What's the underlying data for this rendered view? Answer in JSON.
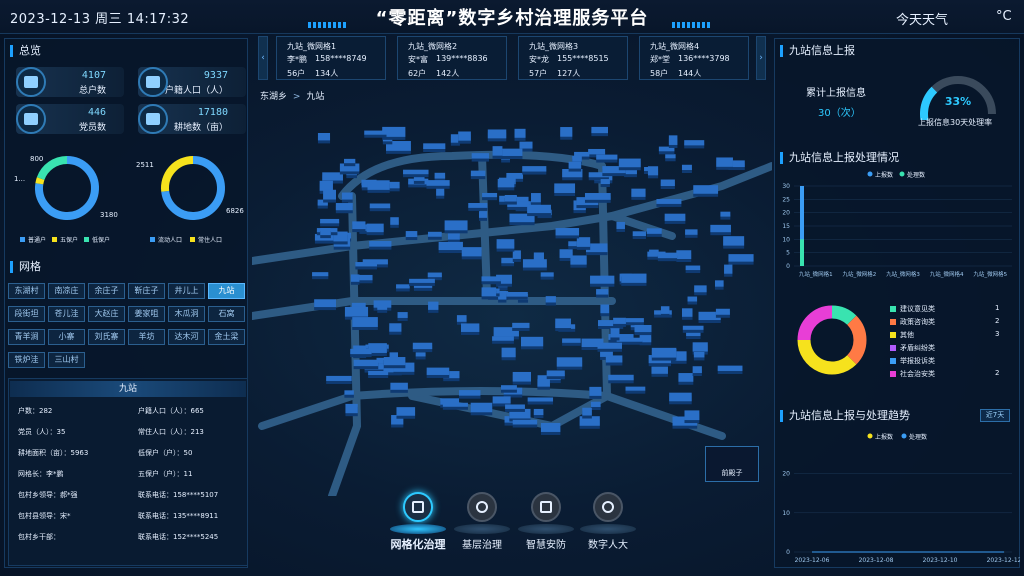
{
  "header": {
    "datetime": "2023-12-13 周三 14:17:32",
    "title": "“零距离”数字乡村治理服务平台",
    "weather_label": "今天天气",
    "temp_unit": "°C"
  },
  "overview": {
    "title": "总览",
    "stats": [
      {
        "value": "4107",
        "label": "总户数",
        "icon": "household-icon"
      },
      {
        "value": "9337",
        "label": "户籍人口（人）",
        "icon": "population-icon"
      },
      {
        "value": "446",
        "label": "党员数",
        "icon": "party-member-icon"
      },
      {
        "value": "17180",
        "label": "耕地数（亩）",
        "icon": "farmland-icon"
      }
    ],
    "donut1": {
      "labels": [
        "800",
        "1...",
        "3180"
      ],
      "legend": [
        "普通户",
        "五保户",
        "低保户"
      ],
      "colors": [
        "#3b9df5",
        "#f6e21d",
        "#39e3b0"
      ],
      "values": [
        3180,
        127,
        800
      ]
    },
    "donut2": {
      "labels": [
        "2511",
        "6826"
      ],
      "legend": [
        "流动人口",
        "常住人口"
      ],
      "colors": [
        "#3b9df5",
        "#f6e21d"
      ],
      "values": [
        6826,
        2511
      ]
    }
  },
  "grid": {
    "title": "网格",
    "buttons": [
      "东湖村",
      "南凉庄",
      "余庄子",
      "靳庄子",
      "井儿上",
      "九站",
      "段街坦",
      "苍儿洼",
      "大赵庄",
      "姜家咀",
      "木瓜洞",
      "石窝",
      "青羊涧",
      "小寨",
      "刘氏寨",
      "羊坊",
      "达木河",
      "金土梁",
      "铁炉洼",
      "三山村"
    ],
    "active": "九站"
  },
  "station_info": {
    "title": "九站",
    "rows": [
      [
        "户数：282",
        "户籍人口（人）：665"
      ],
      [
        "党员（人）：35",
        "常住人口（人）：213"
      ],
      [
        "耕地面积（亩）：5963",
        "低保户（户）：50"
      ],
      [
        "网格长：李*鹏",
        "五保户（户）：11"
      ],
      [
        "包村乡领导：郝*强",
        "联系电话：158****5107"
      ],
      [
        "包村县领导：宋*",
        "联系电话：135****8911"
      ],
      [
        "包村乡干部：",
        "联系电话：152****5245"
      ]
    ]
  },
  "cards": [
    {
      "name": "九站_微网格1",
      "person": "李*鹏",
      "phone": "158****8749",
      "households": "56户",
      "people": "134人"
    },
    {
      "name": "九站_微网格2",
      "person": "安*富",
      "phone": "139****8836",
      "households": "62户",
      "people": "142人"
    },
    {
      "name": "九站_微网格3",
      "person": "安*龙",
      "phone": "155****8515",
      "households": "57户",
      "people": "127人"
    },
    {
      "name": "九站_微网格4",
      "person": "郑*堂",
      "phone": "136****3798",
      "households": "58户",
      "people": "144人"
    }
  ],
  "breadcrumb": {
    "root": "东湖乡",
    "sep": ">",
    "current": "九站"
  },
  "map": {
    "mini_label": "前殿子"
  },
  "bottom_nav": [
    {
      "label": "网格化治理",
      "icon": "grid-icon",
      "active": true
    },
    {
      "label": "基层治理",
      "icon": "gauge-icon",
      "active": false
    },
    {
      "label": "智慧安防",
      "icon": "camera-icon",
      "active": false
    },
    {
      "label": "数字人大",
      "icon": "people-icon",
      "active": false
    }
  ],
  "report": {
    "title": "九站信息上报",
    "cum_label": "累计上报信息",
    "cum_value": "30（次）",
    "rate_value": "33%",
    "rate_percent": 33,
    "rate_label": "上报信息30天处理率"
  },
  "report_status": {
    "title": "九站信息上报处理情况",
    "legend": [
      "上报数",
      "处理数"
    ],
    "chart_data": {
      "type": "bar",
      "categories": [
        "九站_微网格1",
        "九站_微网格2",
        "九站_微网格3",
        "九站_微网格4",
        "九站_微网格5"
      ],
      "series": [
        {
          "name": "上报数",
          "values": [
            30,
            0,
            0,
            0,
            0
          ]
        },
        {
          "name": "处理数",
          "values": [
            10,
            0,
            0,
            0,
            0
          ]
        }
      ],
      "yticks": [
        "30",
        "25",
        "20",
        "15",
        "10",
        "5",
        "0"
      ],
      "ylim": [
        0,
        30
      ]
    }
  },
  "category_pie": {
    "chart_data": {
      "type": "pie",
      "labels": [
        "建议意见类",
        "政策咨询类",
        "其他",
        "矛盾纠纷类",
        "举报投诉类",
        "社会治安类"
      ],
      "values": [
        1,
        2,
        3,
        0,
        0,
        2
      ],
      "counts": [
        "1",
        "2",
        "3",
        "",
        "",
        "2"
      ],
      "colors": [
        "#39e3b0",
        "#ff7a45",
        "#f6e21d",
        "#b25cff",
        "#3b9df5",
        "#e83ed6"
      ]
    }
  },
  "trend": {
    "title": "九站信息上报与处理趋势",
    "range_button": "近7天",
    "legend": [
      "上报数",
      "处理数"
    ],
    "chart_data": {
      "type": "line",
      "x": [
        "2023-12-06",
        "2023-12-08",
        "2023-12-10",
        "2023-12-12"
      ],
      "yticks": [
        "20",
        "10",
        "0"
      ],
      "series": [
        {
          "name": "上报数",
          "values": [
            0,
            0,
            0,
            0
          ]
        },
        {
          "name": "处理数",
          "values": [
            0,
            0,
            0,
            0
          ]
        }
      ],
      "ylim": [
        0,
        25
      ]
    }
  }
}
